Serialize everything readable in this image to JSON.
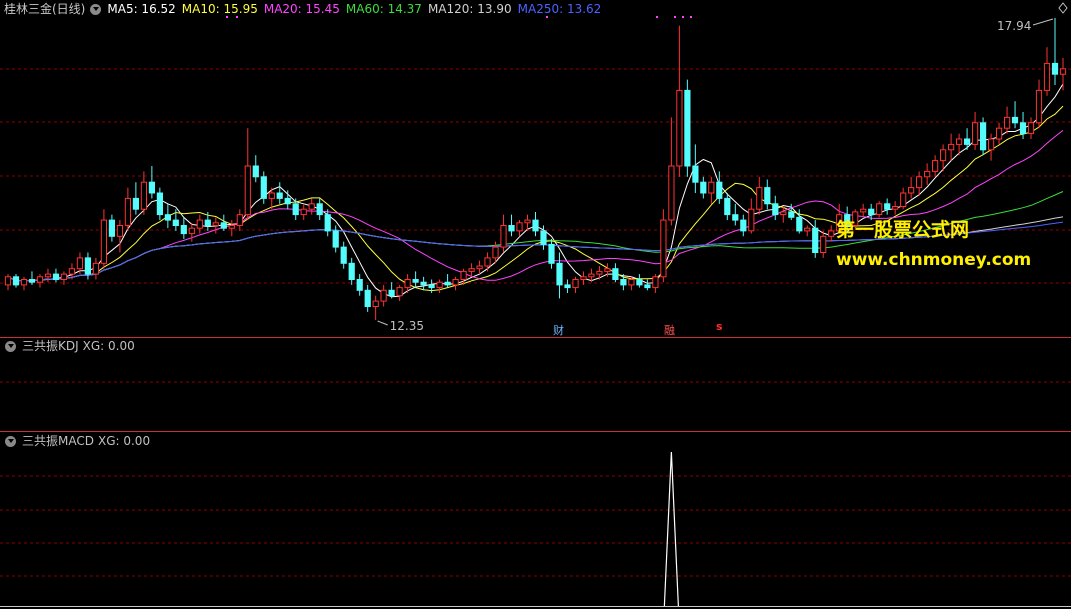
{
  "stock": {
    "title": "桂林三金(日线)",
    "ma": [
      {
        "label": "MA5: 16.52",
        "color": "#ffffff"
      },
      {
        "label": "MA10: 15.95",
        "color": "#ffff3c"
      },
      {
        "label": "MA20: 15.45",
        "color": "#ff44ff"
      },
      {
        "label": "MA60: 14.37",
        "color": "#3cdc3c"
      },
      {
        "label": "MA120: 13.90",
        "color": "#d0d0d0"
      },
      {
        "label": "MA250: 13.62",
        "color": "#4a63ff"
      }
    ],
    "high_label": "17.94",
    "low_label": "12.35"
  },
  "markers": {
    "cai": "财",
    "rong": "融",
    "s": "s"
  },
  "kdj": {
    "title": "三共振KDJ",
    "xg": "XG: 0.00"
  },
  "macd": {
    "title": "三共振MACD",
    "xg": "XG: 0.00"
  },
  "watermark": {
    "cn": "第一股票公式网",
    "url": "www.chnmoney.com"
  },
  "colors": {
    "up": "#ff3232",
    "down": "#54fcfc",
    "grid": "#8b0000",
    "divider": "#c83232",
    "spike": "#ffffff"
  },
  "chart_data": {
    "type": "candlestick",
    "ohlc": [
      [
        13.0,
        13.2,
        12.9,
        13.15
      ],
      [
        13.15,
        13.2,
        12.95,
        13.0
      ],
      [
        13.0,
        13.15,
        12.9,
        13.1
      ],
      [
        13.1,
        13.25,
        13.0,
        13.05
      ],
      [
        13.05,
        13.2,
        12.95,
        13.15
      ],
      [
        13.15,
        13.3,
        13.05,
        13.2
      ],
      [
        13.2,
        13.3,
        13.05,
        13.1
      ],
      [
        13.1,
        13.25,
        13.0,
        13.2
      ],
      [
        13.2,
        13.4,
        13.1,
        13.3
      ],
      [
        13.3,
        13.6,
        13.2,
        13.5
      ],
      [
        13.5,
        13.6,
        13.1,
        13.2
      ],
      [
        13.2,
        13.5,
        13.1,
        13.4
      ],
      [
        13.4,
        14.4,
        13.3,
        14.2
      ],
      [
        14.2,
        14.3,
        13.8,
        13.9
      ],
      [
        13.9,
        14.2,
        13.6,
        14.1
      ],
      [
        14.1,
        14.8,
        14.0,
        14.6
      ],
      [
        14.6,
        14.9,
        14.3,
        14.4
      ],
      [
        14.4,
        15.1,
        14.3,
        14.9
      ],
      [
        14.9,
        15.2,
        14.6,
        14.7
      ],
      [
        14.7,
        14.8,
        14.2,
        14.3
      ],
      [
        14.3,
        14.5,
        14.05,
        14.2
      ],
      [
        14.2,
        14.4,
        14.0,
        14.1
      ],
      [
        14.1,
        14.25,
        13.85,
        13.95
      ],
      [
        13.95,
        14.15,
        13.8,
        14.05
      ],
      [
        14.05,
        14.3,
        13.95,
        14.2
      ],
      [
        14.2,
        14.35,
        14.0,
        14.1
      ],
      [
        14.1,
        14.25,
        13.95,
        14.15
      ],
      [
        14.15,
        14.3,
        14.0,
        14.05
      ],
      [
        14.05,
        14.2,
        13.9,
        14.1
      ],
      [
        14.1,
        14.4,
        14.0,
        14.3
      ],
      [
        14.3,
        15.9,
        14.2,
        15.2
      ],
      [
        15.2,
        15.4,
        14.9,
        15.0
      ],
      [
        15.0,
        15.1,
        14.5,
        14.6
      ],
      [
        14.6,
        14.8,
        14.4,
        14.7
      ],
      [
        14.7,
        14.9,
        14.5,
        14.6
      ],
      [
        14.6,
        14.75,
        14.4,
        14.5
      ],
      [
        14.5,
        14.6,
        14.2,
        14.3
      ],
      [
        14.3,
        14.5,
        14.2,
        14.4
      ],
      [
        14.4,
        14.6,
        14.3,
        14.5
      ],
      [
        14.5,
        14.6,
        14.2,
        14.3
      ],
      [
        14.3,
        14.4,
        13.9,
        14.0
      ],
      [
        14.0,
        14.1,
        13.6,
        13.7
      ],
      [
        13.7,
        13.8,
        13.3,
        13.4
      ],
      [
        13.4,
        13.5,
        13.0,
        13.1
      ],
      [
        13.1,
        13.2,
        12.8,
        12.9
      ],
      [
        12.9,
        13.0,
        12.5,
        12.6
      ],
      [
        12.6,
        12.8,
        12.35,
        12.7
      ],
      [
        12.7,
        13.0,
        12.6,
        12.9
      ],
      [
        12.9,
        13.05,
        12.75,
        12.8
      ],
      [
        12.8,
        13.0,
        12.7,
        12.95
      ],
      [
        12.95,
        13.2,
        12.85,
        13.1
      ],
      [
        13.1,
        13.25,
        12.95,
        13.05
      ],
      [
        13.05,
        13.15,
        12.9,
        13.0
      ],
      [
        13.0,
        13.1,
        12.85,
        12.95
      ],
      [
        12.95,
        13.1,
        12.85,
        13.05
      ],
      [
        13.05,
        13.2,
        12.95,
        13.0
      ],
      [
        13.0,
        13.15,
        12.9,
        13.1
      ],
      [
        13.1,
        13.3,
        13.0,
        13.25
      ],
      [
        13.25,
        13.4,
        13.15,
        13.3
      ],
      [
        13.3,
        13.45,
        13.2,
        13.35
      ],
      [
        13.35,
        13.6,
        13.25,
        13.5
      ],
      [
        13.5,
        13.8,
        13.4,
        13.7
      ],
      [
        13.7,
        14.3,
        13.6,
        14.1
      ],
      [
        14.1,
        14.3,
        13.9,
        14.0
      ],
      [
        14.0,
        14.2,
        13.9,
        14.15
      ],
      [
        14.15,
        14.3,
        14.0,
        14.2
      ],
      [
        14.2,
        14.35,
        13.9,
        14.0
      ],
      [
        14.0,
        14.1,
        13.65,
        13.75
      ],
      [
        13.75,
        13.85,
        13.3,
        13.4
      ],
      [
        13.4,
        13.6,
        12.75,
        13.0
      ],
      [
        13.0,
        13.1,
        12.85,
        12.95
      ],
      [
        12.95,
        13.15,
        12.85,
        13.1
      ],
      [
        13.1,
        13.25,
        13.0,
        13.15
      ],
      [
        13.15,
        13.3,
        13.05,
        13.2
      ],
      [
        13.2,
        13.35,
        13.1,
        13.25
      ],
      [
        13.25,
        13.4,
        13.15,
        13.3
      ],
      [
        13.3,
        13.4,
        13.05,
        13.1
      ],
      [
        13.1,
        13.2,
        12.9,
        13.0
      ],
      [
        13.0,
        13.15,
        12.9,
        13.1
      ],
      [
        13.1,
        13.2,
        12.95,
        13.0
      ],
      [
        13.0,
        13.1,
        12.9,
        12.95
      ],
      [
        12.95,
        13.2,
        12.85,
        13.15
      ],
      [
        13.15,
        14.4,
        13.05,
        14.2
      ],
      [
        14.2,
        16.1,
        14.1,
        15.2
      ],
      [
        15.2,
        17.8,
        15.0,
        16.6
      ],
      [
        16.6,
        16.8,
        15.0,
        15.2
      ],
      [
        15.2,
        15.6,
        14.7,
        14.9
      ],
      [
        14.9,
        15.0,
        14.6,
        14.7
      ],
      [
        14.7,
        15.0,
        14.5,
        14.9
      ],
      [
        14.9,
        15.1,
        14.5,
        14.6
      ],
      [
        14.6,
        14.7,
        14.2,
        14.3
      ],
      [
        14.3,
        14.5,
        14.1,
        14.2
      ],
      [
        14.2,
        14.3,
        13.9,
        14.0
      ],
      [
        14.0,
        14.6,
        13.95,
        14.4
      ],
      [
        14.4,
        15.0,
        14.3,
        14.8
      ],
      [
        14.8,
        14.95,
        14.4,
        14.5
      ],
      [
        14.5,
        14.65,
        14.2,
        14.3
      ],
      [
        14.3,
        14.45,
        14.15,
        14.35
      ],
      [
        14.35,
        14.5,
        14.2,
        14.25
      ],
      [
        14.25,
        14.4,
        13.95,
        14.0
      ],
      [
        14.0,
        14.1,
        13.9,
        14.05
      ],
      [
        14.05,
        14.2,
        13.5,
        13.6
      ],
      [
        13.6,
        14.0,
        13.5,
        13.9
      ],
      [
        13.9,
        14.1,
        13.8,
        14.0
      ],
      [
        14.0,
        14.5,
        13.95,
        14.3
      ],
      [
        14.3,
        14.45,
        14.0,
        14.1
      ],
      [
        14.1,
        14.4,
        14.05,
        14.35
      ],
      [
        14.35,
        14.5,
        14.25,
        14.4
      ],
      [
        14.4,
        14.5,
        14.2,
        14.3
      ],
      [
        14.3,
        14.55,
        14.25,
        14.5
      ],
      [
        14.5,
        14.6,
        14.3,
        14.4
      ],
      [
        14.4,
        14.55,
        14.3,
        14.45
      ],
      [
        14.45,
        14.8,
        14.4,
        14.7
      ],
      [
        14.7,
        15.0,
        14.6,
        14.8
      ],
      [
        14.8,
        15.1,
        14.65,
        15.0
      ],
      [
        15.0,
        15.25,
        14.85,
        15.1
      ],
      [
        15.1,
        15.4,
        15.0,
        15.3
      ],
      [
        15.3,
        15.6,
        15.1,
        15.5
      ],
      [
        15.5,
        15.8,
        15.3,
        15.6
      ],
      [
        15.6,
        15.8,
        15.4,
        15.7
      ],
      [
        15.7,
        15.9,
        15.5,
        15.6
      ],
      [
        15.6,
        16.2,
        15.5,
        16.0
      ],
      [
        16.0,
        16.1,
        15.4,
        15.5
      ],
      [
        15.5,
        15.8,
        15.3,
        15.7
      ],
      [
        15.7,
        16.0,
        15.6,
        15.9
      ],
      [
        15.9,
        16.3,
        15.8,
        16.1
      ],
      [
        16.1,
        16.4,
        15.9,
        16.0
      ],
      [
        16.0,
        16.2,
        15.7,
        15.8
      ],
      [
        15.8,
        16.1,
        15.7,
        16.0
      ],
      [
        16.0,
        16.8,
        15.9,
        16.6
      ],
      [
        16.6,
        17.4,
        16.5,
        17.1
      ],
      [
        17.1,
        17.94,
        16.7,
        16.9
      ],
      [
        16.9,
        17.2,
        16.6,
        17.0
      ]
    ],
    "high": 17.94,
    "low": 12.35,
    "macd_xg_signal_index": 83
  }
}
